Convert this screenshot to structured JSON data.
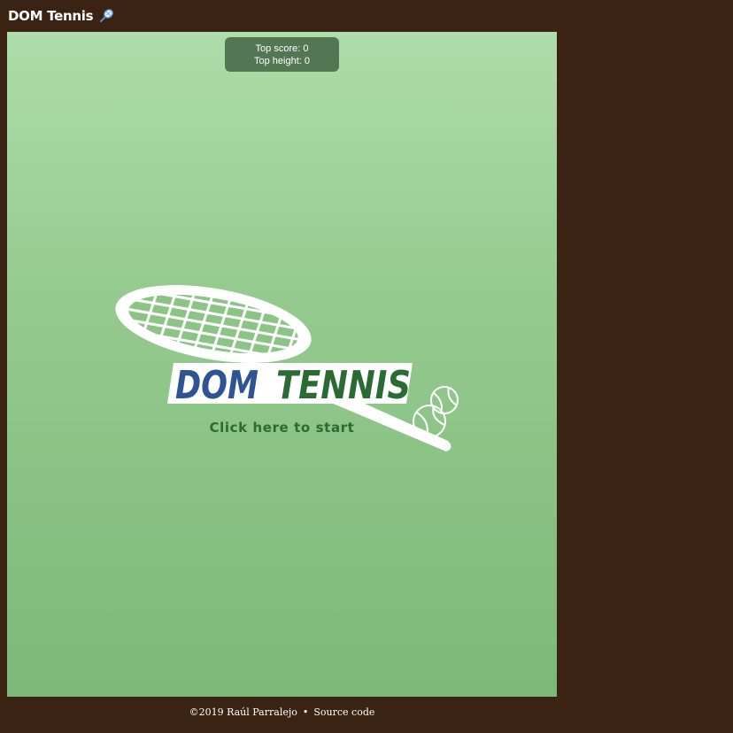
{
  "header": {
    "title": "DOM Tennis",
    "icon": "tennis-racket-icon"
  },
  "scoreboard": {
    "top_score_label": "Top score: 0",
    "top_height_label": "Top height: 0"
  },
  "logo": {
    "word1": "DOM",
    "word2": "TENNIS",
    "word1_color": "#2f5496",
    "word2_color": "#2b6a32",
    "racket_icon": "tennis-racket-icon",
    "ball_icon": "tennis-ball-icon"
  },
  "start_prompt": "Click here to start",
  "footer": {
    "copyright": "©2019 Raúl Parralejo",
    "separator": "•",
    "source_link": "Source code"
  },
  "colors": {
    "page_background": "#3b2314",
    "court_top": "#aedcaa",
    "court_bottom": "#7cb978"
  }
}
